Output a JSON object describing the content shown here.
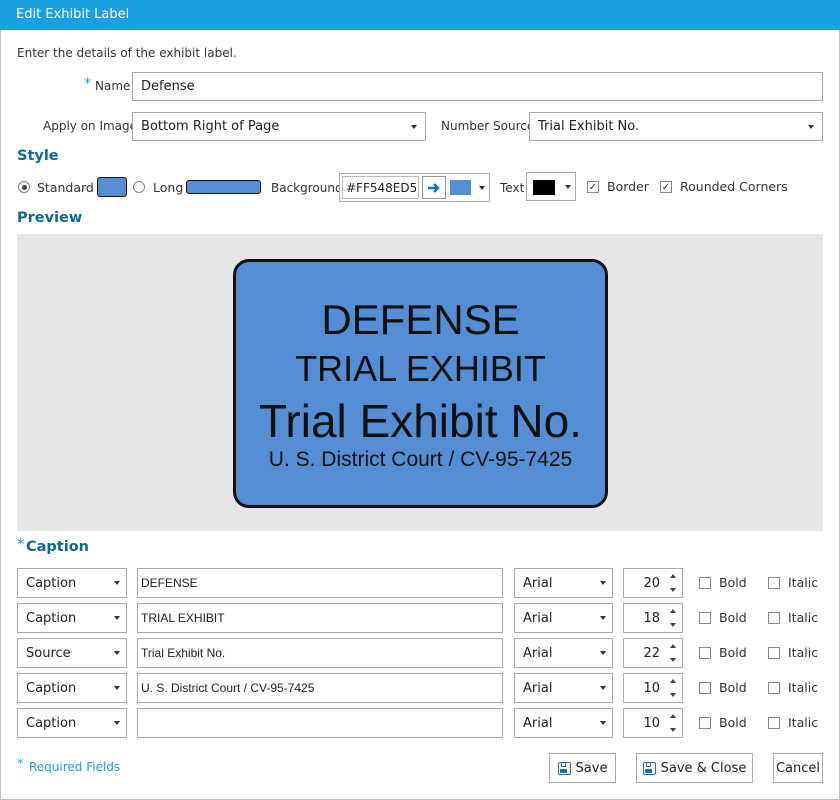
{
  "window": {
    "title": "Edit Exhibit Label"
  },
  "intro": "Enter the details of the exhibit label.",
  "name_field": {
    "required_mark": "*",
    "label": "Name",
    "value": "Defense"
  },
  "apply_on_image": {
    "label": "Apply on Image",
    "value": "Bottom Right of Page"
  },
  "number_source": {
    "label": "Number Source",
    "value": "Trial Exhibit No."
  },
  "style": {
    "heading": "Style",
    "standard_label": "Standard",
    "long_label": "Long",
    "selected": "Standard",
    "background_label": "Background",
    "background_value": "#FF548ED5",
    "text_label": "Text",
    "text_color": "#000000",
    "border_label": "Border",
    "border_checked": true,
    "rounded_label": "Rounded Corners",
    "rounded_checked": true,
    "label_color": "#548ED5"
  },
  "preview": {
    "heading": "Preview",
    "lines": [
      "DEFENSE",
      "TRIAL EXHIBIT",
      "Trial Exhibit No.",
      "U. S. District Court / CV-95-7425"
    ]
  },
  "caption": {
    "required_mark": "*",
    "heading": "Caption",
    "bold_label": "Bold",
    "italic_label": "Italic",
    "rows": [
      {
        "type": "Caption",
        "text": "DEFENSE",
        "font": "Arial",
        "size": "20",
        "bold": false,
        "italic": false
      },
      {
        "type": "Caption",
        "text": "TRIAL EXHIBIT",
        "font": "Arial",
        "size": "18",
        "bold": false,
        "italic": false
      },
      {
        "type": "Source",
        "text": "Trial Exhibit No.",
        "font": "Arial",
        "size": "22",
        "bold": false,
        "italic": false
      },
      {
        "type": "Caption",
        "text": "U. S. District Court / CV-95-7425",
        "font": "Arial",
        "size": "10",
        "bold": false,
        "italic": false
      },
      {
        "type": "Caption",
        "text": "",
        "font": "Arial",
        "size": "10",
        "bold": false,
        "italic": false
      }
    ]
  },
  "footer": {
    "required_mark": "*",
    "required_text": "Required Fields",
    "save": "Save",
    "save_close": "Save & Close",
    "cancel": "Cancel"
  }
}
